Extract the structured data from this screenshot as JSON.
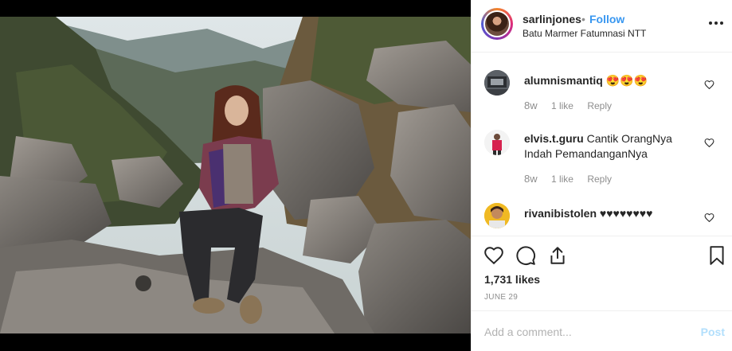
{
  "header": {
    "username": "sarlinjones",
    "separator": "•",
    "follow_label": "Follow",
    "location": "Batu Marmer Fatumnasi NTT",
    "more_icon": "more-options-icon"
  },
  "comments": [
    {
      "username": "alumnismantiq",
      "text": "😍😍😍",
      "age": "8w",
      "likes": "1 like",
      "reply_label": "Reply"
    },
    {
      "username": "elvis.t.guru",
      "text": "Cantik OrangNya Indah PemandanganNya",
      "age": "8w",
      "likes": "1 like",
      "reply_label": "Reply"
    },
    {
      "username": "rivanibistolen",
      "text": "♥♥♥♥♥♥♥♥"
    }
  ],
  "actions": {
    "like_icon": "heart-icon",
    "comment_icon": "comment-icon",
    "share_icon": "share-icon",
    "save_icon": "bookmark-icon"
  },
  "likes_text": "1,731 likes",
  "date": "JUNE 29",
  "composer": {
    "placeholder": "Add a comment...",
    "post_label": "Post"
  },
  "colors": {
    "link_blue": "#3897f0",
    "muted_gray": "#8e8e8e",
    "border": "#efefef",
    "post_disabled": "#b2dffc"
  }
}
